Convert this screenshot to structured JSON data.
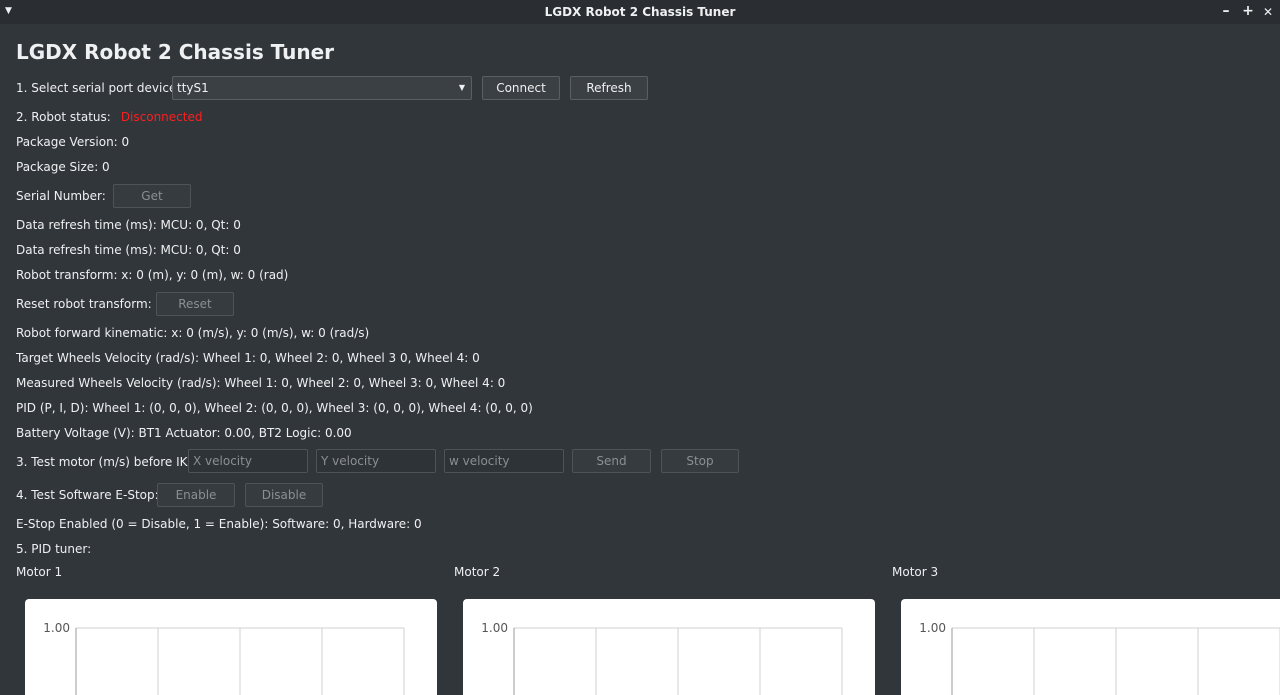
{
  "window": {
    "title": "LGDX Robot 2 Chassis Tuner",
    "menu_icon": "chevron-down-icon",
    "controls": [
      "minimize-icon",
      "maximize-icon",
      "close-icon"
    ],
    "minimize_glyph": "–",
    "maximize_glyph": "+",
    "close_glyph": "✕"
  },
  "app_title": "LGDX Robot 2 Chassis Tuner",
  "serial": {
    "label": "1. Select serial port device:",
    "selected": "ttyS1",
    "connect_label": "Connect",
    "refresh_label": "Refresh"
  },
  "status": {
    "label": "2. Robot status:",
    "value": "Disconnected",
    "value_color": "#ff1e1e"
  },
  "info": {
    "package_version": "Package Version: 0",
    "package_size": "Package Size: 0",
    "serial_number_label": "Serial Number:",
    "get_label": "Get",
    "refresh_time_1": "Data refresh time (ms): MCU: 0, Qt: 0",
    "refresh_time_2": "Data refresh time (ms): MCU: 0, Qt: 0",
    "transform": "Robot transform: x: 0 (m), y: 0 (m), w: 0 (rad)",
    "reset_transform_label": "Reset robot transform:",
    "reset_label": "Reset",
    "forward_kinematic": "Robot forward kinematic: x: 0 (m/s), y: 0 (m/s), w: 0 (rad/s)",
    "target_velocity": "Target Wheels Velocity (rad/s): Wheel 1: 0, Wheel 2: 0, Wheel 3 0, Wheel 4: 0",
    "measured_velocity": "Measured Wheels Velocity (rad/s): Wheel 1: 0, Wheel 2: 0, Wheel 3: 0, Wheel 4: 0",
    "pid": "PID (P, I, D): Wheel 1: (0, 0, 0), Wheel 2: (0, 0, 0), Wheel 3: (0, 0, 0), Wheel 4: (0, 0, 0)",
    "battery": "Battery Voltage (V): BT1 Actuator: 0.00, BT2 Logic: 0.00"
  },
  "test_motor": {
    "label": "3. Test motor (m/s) before IK:",
    "x_placeholder": "X velocity",
    "y_placeholder": "Y velocity",
    "w_placeholder": "w velocity",
    "send_label": "Send",
    "stop_label": "Stop"
  },
  "estop": {
    "label": "4. Test Software E-Stop:",
    "enable_label": "Enable",
    "disable_label": "Disable",
    "state": "E-Stop Enabled (0 = Disable, 1 = Enable): Software: 0, Hardware: 0"
  },
  "pid_tuner": {
    "label": "5. PID tuner:",
    "motors": [
      {
        "label": "Motor 1"
      },
      {
        "label": "Motor 2"
      },
      {
        "label": "Motor 3"
      }
    ]
  },
  "chart_data": [
    {
      "type": "line",
      "title": "",
      "y_tick_top": "1.00",
      "ylim": [
        null,
        1.0
      ],
      "grid": true,
      "series": []
    },
    {
      "type": "line",
      "title": "",
      "y_tick_top": "1.00",
      "ylim": [
        null,
        1.0
      ],
      "grid": true,
      "series": []
    },
    {
      "type": "line",
      "title": "",
      "y_tick_top": "1.00",
      "ylim": [
        null,
        1.0
      ],
      "grid": true,
      "series": []
    }
  ]
}
